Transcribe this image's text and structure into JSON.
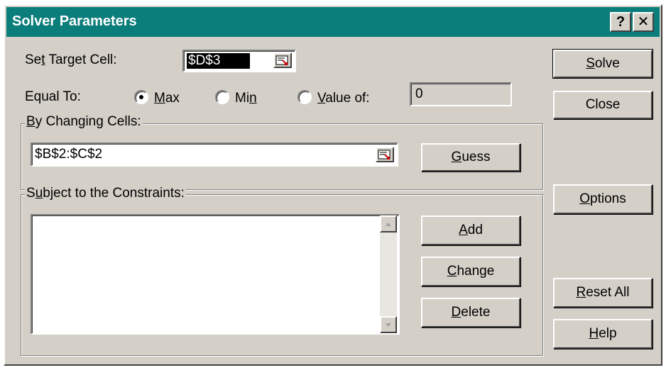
{
  "dialog": {
    "title": "Solver Parameters",
    "help_button": "?",
    "close_button": "✕"
  },
  "target": {
    "label_pre": "Se",
    "label_u": "t",
    "label_post": " Target Cell:",
    "value": "$D$3"
  },
  "equal_to": {
    "label": "Equal To:",
    "max_u": "M",
    "max_rest": "ax",
    "min_pre": "Mi",
    "min_u": "n",
    "value_u": "V",
    "value_rest": "alue of:",
    "value_input": "0",
    "selected": "Max"
  },
  "changing": {
    "legend_u": "B",
    "legend_rest": "y Changing Cells:",
    "value": "$B$2:$C$2",
    "guess_u": "G",
    "guess_rest": "uess"
  },
  "constraints": {
    "legend_pre": "S",
    "legend_u": "u",
    "legend_rest": "bject to the Constraints:",
    "add_u": "A",
    "add_rest": "dd",
    "change_u": "C",
    "change_rest": "hange",
    "delete_u": "D",
    "delete_rest": "elete"
  },
  "side_buttons": {
    "solve_u": "S",
    "solve_rest": "olve",
    "close": "Close",
    "options_u": "O",
    "options_rest": "ptions",
    "reset_u": "R",
    "reset_rest": "eset All",
    "help_u": "H",
    "help_rest": "elp"
  },
  "colors": {
    "titlebar": "#0b7d7b",
    "face": "#d4d0c8"
  }
}
